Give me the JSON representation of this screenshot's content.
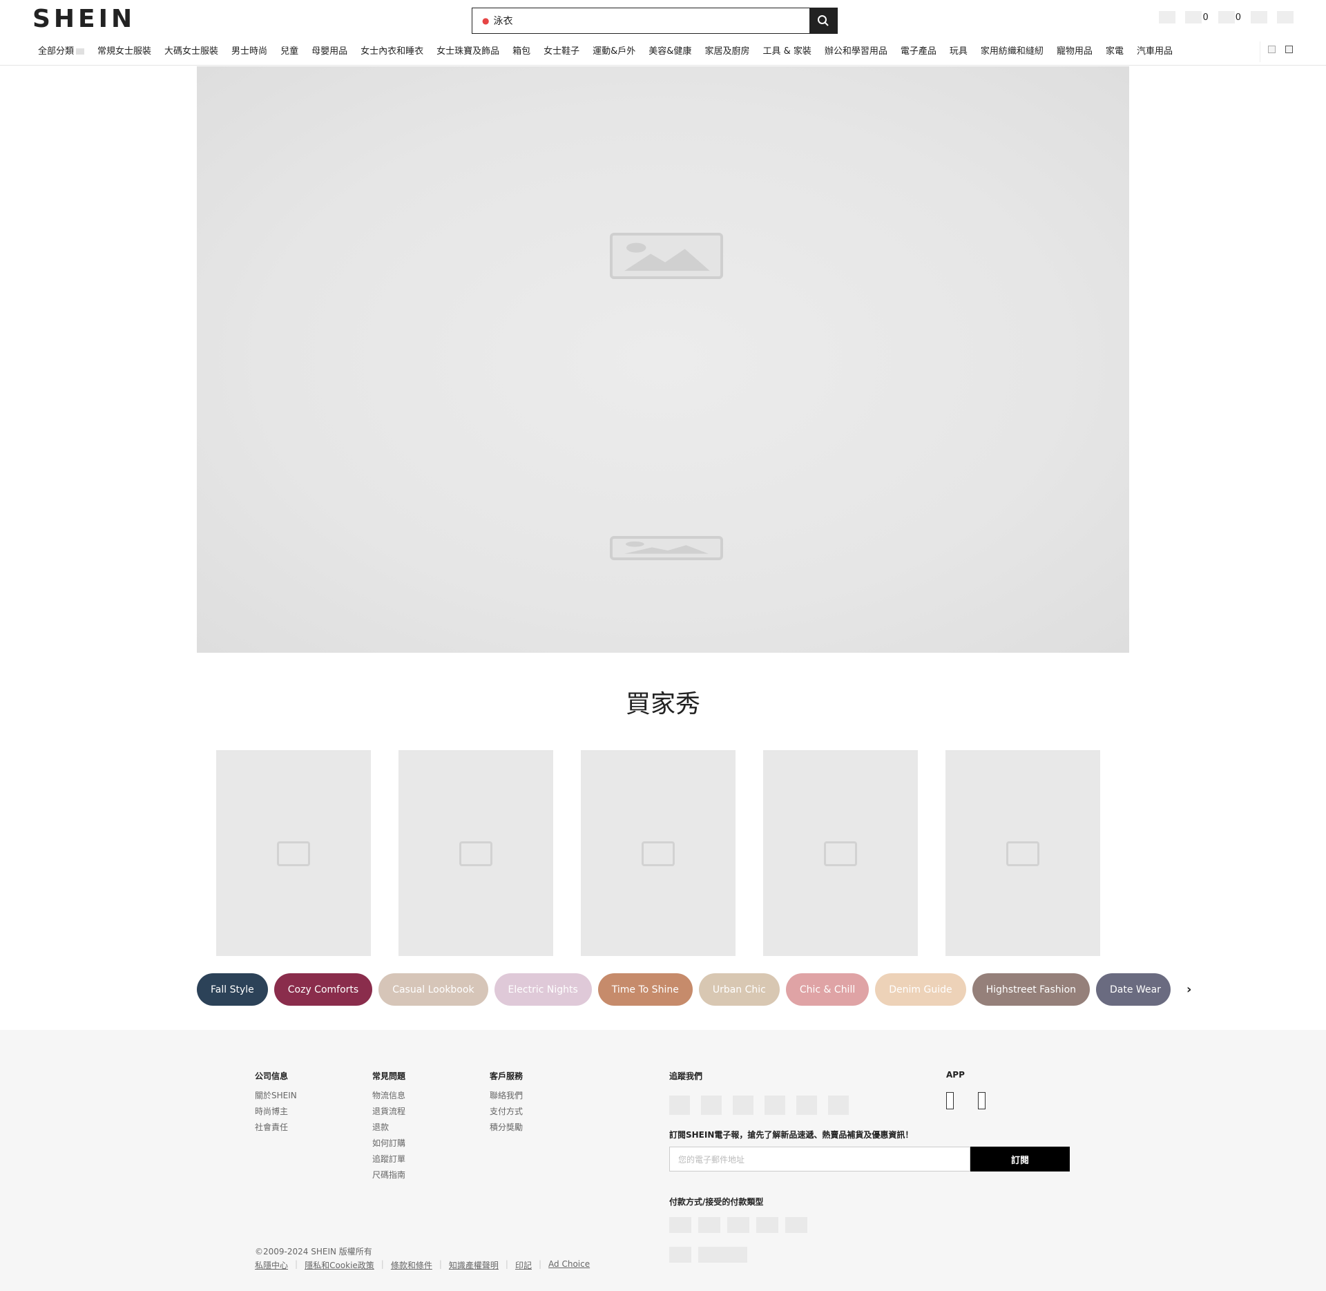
{
  "header": {
    "logo": "SHEIN",
    "search": {
      "value": "泳衣"
    },
    "wishlist_count": "0",
    "cart_count": "0"
  },
  "nav": {
    "items": [
      "全部分類",
      "常規女士服裝",
      "大碼女士服裝",
      "男士時尚",
      "兒童",
      "母嬰用品",
      "女士內衣和睡衣",
      "女士珠寶及飾品",
      "箱包",
      "女士鞋子",
      "運動&戶外",
      "美容&健康",
      "家居及廚房",
      "工具 & 家裝",
      "辦公和學習用品",
      "電子產品",
      "玩具",
      "家用紡織和縫紉",
      "寵物用品",
      "家電",
      "汽車用品"
    ]
  },
  "buyer_show": {
    "title": "買家秀",
    "tags": [
      {
        "label": "Fall Style",
        "color": "#2c4258",
        "text_color": "#ffffff"
      },
      {
        "label": "Cozy Comforts",
        "color": "#8a2d4c",
        "text_color": "#ffffff"
      },
      {
        "label": "Casual Lookbook",
        "color": "#d6c5b8",
        "text_color": "#ffffff"
      },
      {
        "label": "Electric Nights",
        "color": "#dfc9d8",
        "text_color": "#ffffff"
      },
      {
        "label": "Time To Shine",
        "color": "#c68b6b",
        "text_color": "#ffffff"
      },
      {
        "label": "Urban Chic",
        "color": "#d8c7b2",
        "text_color": "#ffffff"
      },
      {
        "label": "Chic & Chill",
        "color": "#dfa3a5",
        "text_color": "#ffffff"
      },
      {
        "label": "Denim Guide",
        "color": "#edd2b8",
        "text_color": "#ffffff"
      },
      {
        "label": "Highstreet Fashion",
        "color": "#95807a",
        "text_color": "#ffffff"
      },
      {
        "label": "Date Wear",
        "color": "#6a6b80",
        "text_color": "#ffffff"
      }
    ]
  },
  "footer": {
    "company": {
      "title": "公司信息",
      "links": [
        "關於SHEIN",
        "時尚博主",
        "社會責任"
      ]
    },
    "faq": {
      "title": "常見問題",
      "links": [
        "物流信息",
        "退貨流程",
        "退款",
        "如何訂購",
        "追蹤訂單",
        "尺碼指南"
      ]
    },
    "service": {
      "title": "客戶服務",
      "links": [
        "聯絡我們",
        "支付方式",
        "積分獎勵"
      ]
    },
    "follow_title": "追蹤我們",
    "app_title": "APP",
    "subscribe": {
      "title": "訂閱SHEIN電子報，搶先了解新品速遞、熱賣品補貨及優惠資訊！",
      "placeholder": "您的電子郵件地址",
      "button": "訂閱"
    },
    "payment_title": "付款方式/接受的付款類型",
    "copyright": "©2009-2024 SHEIN 版權所有",
    "legal_links": [
      "私隱中心",
      "隱私和Cookie政策",
      "條款和條件",
      "知識產權聲明",
      "印記",
      "Ad Choice"
    ]
  }
}
